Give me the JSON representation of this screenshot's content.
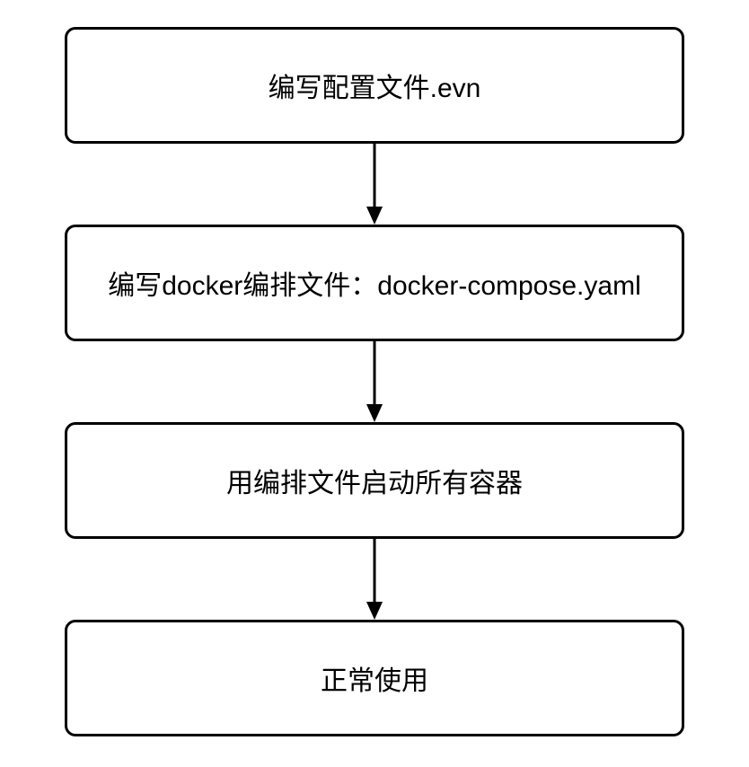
{
  "flowchart": {
    "steps": [
      {
        "label": "编写配置文件.evn"
      },
      {
        "label": "编写docker编排文件：docker-compose.yaml"
      },
      {
        "label": "用编排文件启动所有容器"
      },
      {
        "label": "正常使用"
      }
    ]
  }
}
